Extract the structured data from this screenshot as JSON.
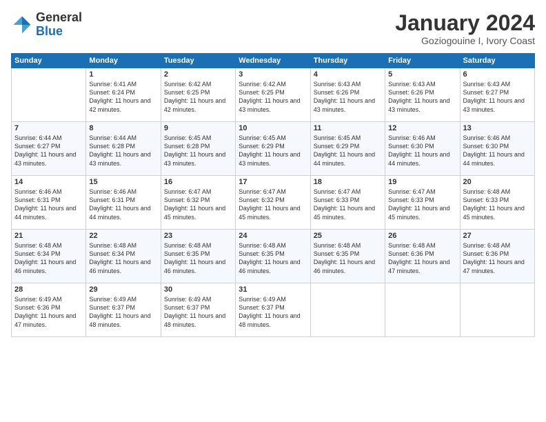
{
  "logo": {
    "general": "General",
    "blue": "Blue"
  },
  "header": {
    "title": "January 2024",
    "subtitle": "Goziogouine I, Ivory Coast"
  },
  "weekdays": [
    "Sunday",
    "Monday",
    "Tuesday",
    "Wednesday",
    "Thursday",
    "Friday",
    "Saturday"
  ],
  "weeks": [
    [
      {
        "day": "",
        "sunrise": "",
        "sunset": "",
        "daylight": ""
      },
      {
        "day": "1",
        "sunrise": "Sunrise: 6:41 AM",
        "sunset": "Sunset: 6:24 PM",
        "daylight": "Daylight: 11 hours and 42 minutes."
      },
      {
        "day": "2",
        "sunrise": "Sunrise: 6:42 AM",
        "sunset": "Sunset: 6:25 PM",
        "daylight": "Daylight: 11 hours and 42 minutes."
      },
      {
        "day": "3",
        "sunrise": "Sunrise: 6:42 AM",
        "sunset": "Sunset: 6:25 PM",
        "daylight": "Daylight: 11 hours and 43 minutes."
      },
      {
        "day": "4",
        "sunrise": "Sunrise: 6:43 AM",
        "sunset": "Sunset: 6:26 PM",
        "daylight": "Daylight: 11 hours and 43 minutes."
      },
      {
        "day": "5",
        "sunrise": "Sunrise: 6:43 AM",
        "sunset": "Sunset: 6:26 PM",
        "daylight": "Daylight: 11 hours and 43 minutes."
      },
      {
        "day": "6",
        "sunrise": "Sunrise: 6:43 AM",
        "sunset": "Sunset: 6:27 PM",
        "daylight": "Daylight: 11 hours and 43 minutes."
      }
    ],
    [
      {
        "day": "7",
        "sunrise": "Sunrise: 6:44 AM",
        "sunset": "Sunset: 6:27 PM",
        "daylight": "Daylight: 11 hours and 43 minutes."
      },
      {
        "day": "8",
        "sunrise": "Sunrise: 6:44 AM",
        "sunset": "Sunset: 6:28 PM",
        "daylight": "Daylight: 11 hours and 43 minutes."
      },
      {
        "day": "9",
        "sunrise": "Sunrise: 6:45 AM",
        "sunset": "Sunset: 6:28 PM",
        "daylight": "Daylight: 11 hours and 43 minutes."
      },
      {
        "day": "10",
        "sunrise": "Sunrise: 6:45 AM",
        "sunset": "Sunset: 6:29 PM",
        "daylight": "Daylight: 11 hours and 43 minutes."
      },
      {
        "day": "11",
        "sunrise": "Sunrise: 6:45 AM",
        "sunset": "Sunset: 6:29 PM",
        "daylight": "Daylight: 11 hours and 44 minutes."
      },
      {
        "day": "12",
        "sunrise": "Sunrise: 6:46 AM",
        "sunset": "Sunset: 6:30 PM",
        "daylight": "Daylight: 11 hours and 44 minutes."
      },
      {
        "day": "13",
        "sunrise": "Sunrise: 6:46 AM",
        "sunset": "Sunset: 6:30 PM",
        "daylight": "Daylight: 11 hours and 44 minutes."
      }
    ],
    [
      {
        "day": "14",
        "sunrise": "Sunrise: 6:46 AM",
        "sunset": "Sunset: 6:31 PM",
        "daylight": "Daylight: 11 hours and 44 minutes."
      },
      {
        "day": "15",
        "sunrise": "Sunrise: 6:46 AM",
        "sunset": "Sunset: 6:31 PM",
        "daylight": "Daylight: 11 hours and 44 minutes."
      },
      {
        "day": "16",
        "sunrise": "Sunrise: 6:47 AM",
        "sunset": "Sunset: 6:32 PM",
        "daylight": "Daylight: 11 hours and 45 minutes."
      },
      {
        "day": "17",
        "sunrise": "Sunrise: 6:47 AM",
        "sunset": "Sunset: 6:32 PM",
        "daylight": "Daylight: 11 hours and 45 minutes."
      },
      {
        "day": "18",
        "sunrise": "Sunrise: 6:47 AM",
        "sunset": "Sunset: 6:33 PM",
        "daylight": "Daylight: 11 hours and 45 minutes."
      },
      {
        "day": "19",
        "sunrise": "Sunrise: 6:47 AM",
        "sunset": "Sunset: 6:33 PM",
        "daylight": "Daylight: 11 hours and 45 minutes."
      },
      {
        "day": "20",
        "sunrise": "Sunrise: 6:48 AM",
        "sunset": "Sunset: 6:33 PM",
        "daylight": "Daylight: 11 hours and 45 minutes."
      }
    ],
    [
      {
        "day": "21",
        "sunrise": "Sunrise: 6:48 AM",
        "sunset": "Sunset: 6:34 PM",
        "daylight": "Daylight: 11 hours and 46 minutes."
      },
      {
        "day": "22",
        "sunrise": "Sunrise: 6:48 AM",
        "sunset": "Sunset: 6:34 PM",
        "daylight": "Daylight: 11 hours and 46 minutes."
      },
      {
        "day": "23",
        "sunrise": "Sunrise: 6:48 AM",
        "sunset": "Sunset: 6:35 PM",
        "daylight": "Daylight: 11 hours and 46 minutes."
      },
      {
        "day": "24",
        "sunrise": "Sunrise: 6:48 AM",
        "sunset": "Sunset: 6:35 PM",
        "daylight": "Daylight: 11 hours and 46 minutes."
      },
      {
        "day": "25",
        "sunrise": "Sunrise: 6:48 AM",
        "sunset": "Sunset: 6:35 PM",
        "daylight": "Daylight: 11 hours and 46 minutes."
      },
      {
        "day": "26",
        "sunrise": "Sunrise: 6:48 AM",
        "sunset": "Sunset: 6:36 PM",
        "daylight": "Daylight: 11 hours and 47 minutes."
      },
      {
        "day": "27",
        "sunrise": "Sunrise: 6:48 AM",
        "sunset": "Sunset: 6:36 PM",
        "daylight": "Daylight: 11 hours and 47 minutes."
      }
    ],
    [
      {
        "day": "28",
        "sunrise": "Sunrise: 6:49 AM",
        "sunset": "Sunset: 6:36 PM",
        "daylight": "Daylight: 11 hours and 47 minutes."
      },
      {
        "day": "29",
        "sunrise": "Sunrise: 6:49 AM",
        "sunset": "Sunset: 6:37 PM",
        "daylight": "Daylight: 11 hours and 48 minutes."
      },
      {
        "day": "30",
        "sunrise": "Sunrise: 6:49 AM",
        "sunset": "Sunset: 6:37 PM",
        "daylight": "Daylight: 11 hours and 48 minutes."
      },
      {
        "day": "31",
        "sunrise": "Sunrise: 6:49 AM",
        "sunset": "Sunset: 6:37 PM",
        "daylight": "Daylight: 11 hours and 48 minutes."
      },
      {
        "day": "",
        "sunrise": "",
        "sunset": "",
        "daylight": ""
      },
      {
        "day": "",
        "sunrise": "",
        "sunset": "",
        "daylight": ""
      },
      {
        "day": "",
        "sunrise": "",
        "sunset": "",
        "daylight": ""
      }
    ]
  ]
}
